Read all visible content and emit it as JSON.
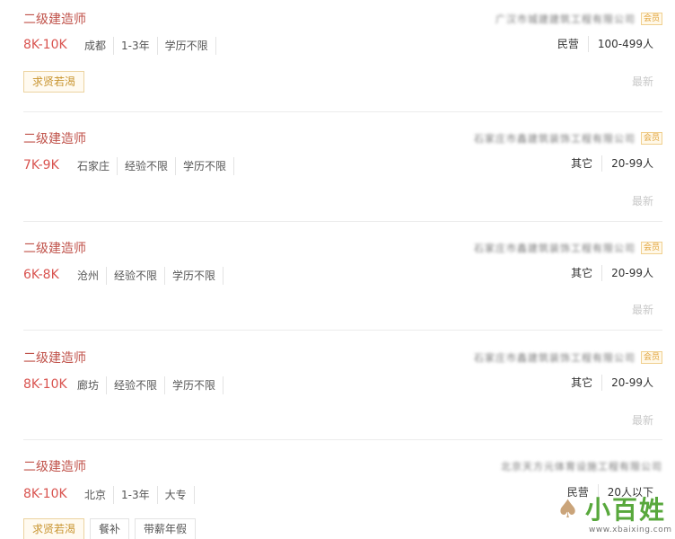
{
  "jobs": [
    {
      "title": "二级建造师",
      "salary": "8K-10K",
      "tags": [
        "成都",
        "1-3年",
        "学历不限"
      ],
      "company": "广汉市城建建筑工程有限公司",
      "badge": "会员",
      "company_type": "民营",
      "company_size": "100-499人",
      "posted": "最新",
      "benefits": [
        "求贤若渴"
      ]
    },
    {
      "title": "二级建造师",
      "salary": "7K-9K",
      "tags": [
        "石家庄",
        "经验不限",
        "学历不限"
      ],
      "company": "石家庄市鑫建筑装饰工程有限公司",
      "badge": "会员",
      "company_type": "其它",
      "company_size": "20-99人",
      "posted": "最新",
      "benefits": []
    },
    {
      "title": "二级建造师",
      "salary": "6K-8K",
      "tags": [
        "沧州",
        "经验不限",
        "学历不限"
      ],
      "company": "石家庄市鑫建筑装饰工程有限公司",
      "badge": "会员",
      "company_type": "其它",
      "company_size": "20-99人",
      "posted": "最新",
      "benefits": []
    },
    {
      "title": "二级建造师",
      "salary": "8K-10K",
      "tags": [
        "廊坊",
        "经验不限",
        "学历不限"
      ],
      "company": "石家庄市鑫建筑装饰工程有限公司",
      "badge": "会员",
      "company_type": "其它",
      "company_size": "20-99人",
      "posted": "最新",
      "benefits": []
    },
    {
      "title": "二级建造师",
      "salary": "8K-10K",
      "tags": [
        "北京",
        "1-3年",
        "大专"
      ],
      "company": "北京天方元体育设施工程有限公司",
      "badge": "",
      "company_type": "民营",
      "company_size": "20人以下",
      "posted": "",
      "benefits": [
        "求贤若渴",
        "餐补",
        "带薪年假"
      ]
    }
  ],
  "watermark": {
    "brand": "小百姓",
    "url": "www.xbaixing.com"
  }
}
